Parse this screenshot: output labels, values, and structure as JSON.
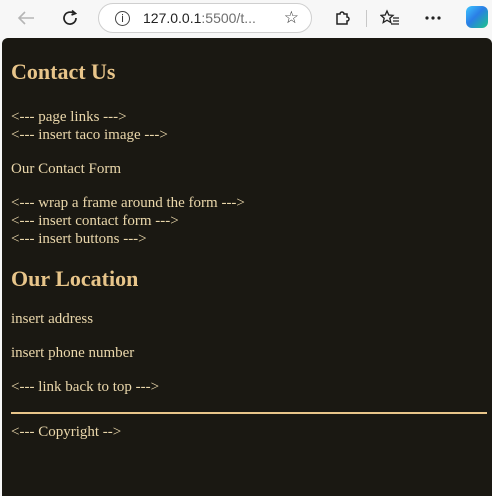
{
  "browser": {
    "url_host": "127.0.0.1",
    "url_rest": ":5500/t..."
  },
  "page": {
    "heading": "Contact Us",
    "page_links_comment": "<--- page links --->",
    "taco_image_comment": "<--- insert taco image --->",
    "contact_form_title": "Our Contact Form",
    "frame_comment": "<--- wrap a frame around the form --->",
    "contact_form_comment": "<--- insert contact form --->",
    "buttons_comment": "<--- insert buttons --->",
    "location_heading": "Our Location",
    "address": "insert address",
    "phone": "insert phone number",
    "back_to_top_comment": "<--- link back to top --->",
    "copyright_comment": "<--- Copyright -->"
  },
  "colors": {
    "page_background": "#1a1812",
    "text": "#ead7ab",
    "heading": "#e8c58a",
    "rule": "#e8c58a"
  },
  "icons": [
    "back-arrow-icon",
    "reload-icon",
    "info-icon",
    "star-icon",
    "extensions-icon",
    "favorites-icon",
    "more-icon",
    "edge-logo"
  ]
}
